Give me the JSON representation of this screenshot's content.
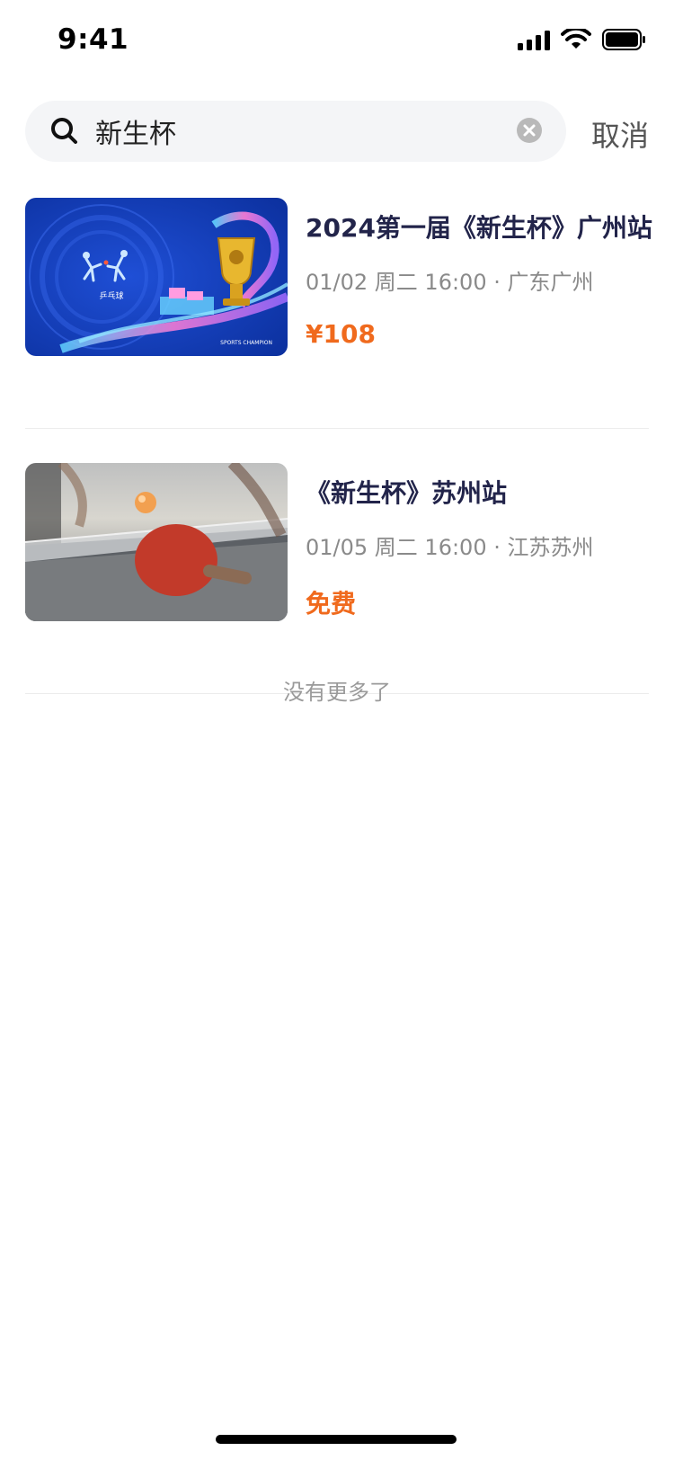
{
  "status_bar": {
    "time": "9:41"
  },
  "search": {
    "query": "新生杯",
    "cancel_label": "取消"
  },
  "results": [
    {
      "title": "2024第一届《新生杯》广州站",
      "meta": "01/02 周二 16:00 · 广东广州",
      "price": "¥108",
      "image": {
        "label": "乒乓球",
        "badge": "SPORTS CHAMPION"
      }
    },
    {
      "title": "《新生杯》苏州站",
      "meta": "01/05 周二 16:00 · 江苏苏州",
      "price": "免费"
    }
  ],
  "footer_text": "没有更多了",
  "colors": {
    "accent": "#f06a1d",
    "title": "#22244a",
    "meta": "#8a8a8a"
  }
}
